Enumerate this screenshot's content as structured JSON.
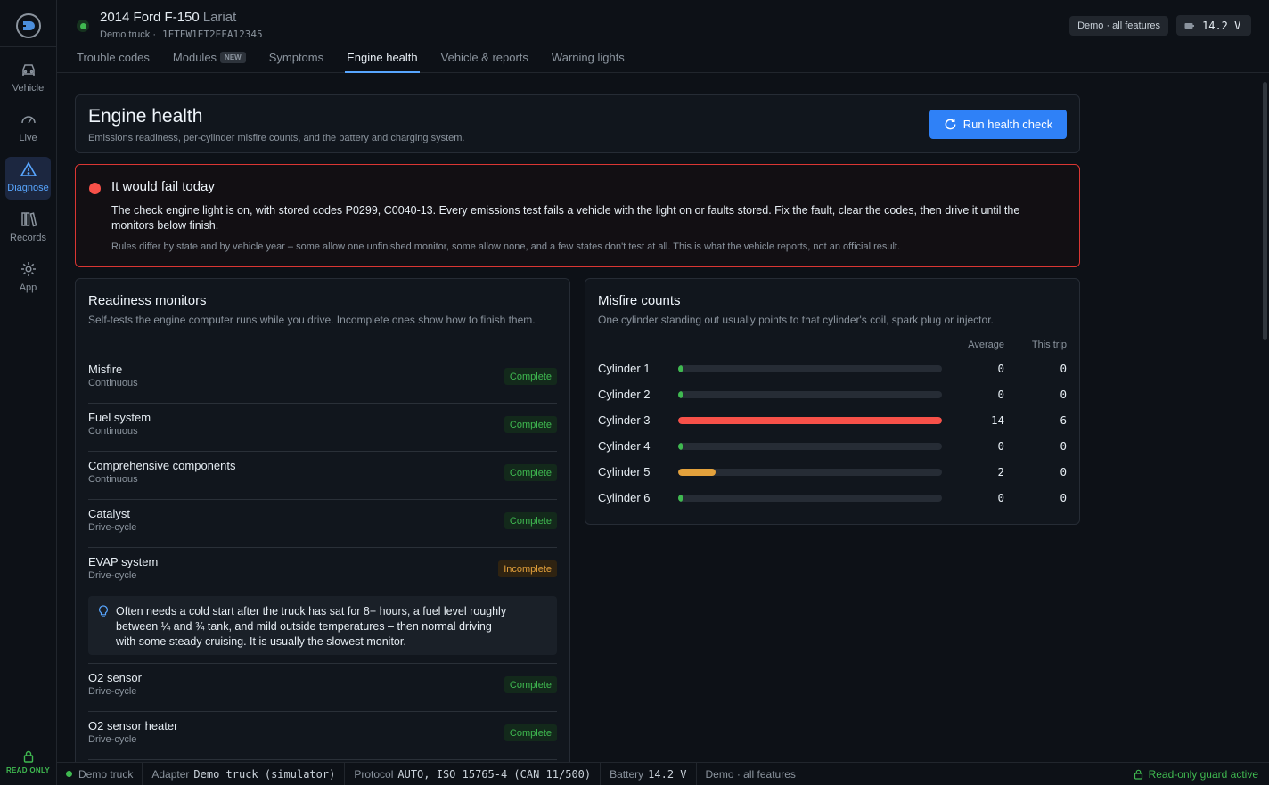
{
  "sidebar": {
    "items": [
      {
        "label": "Vehicle",
        "icon": "car-icon"
      },
      {
        "label": "Live",
        "icon": "gauge-icon"
      },
      {
        "label": "Diagnose",
        "icon": "warning-triangle-icon"
      },
      {
        "label": "Records",
        "icon": "books-icon"
      },
      {
        "label": "App",
        "icon": "gear-icon"
      }
    ],
    "active": "Diagnose",
    "read_only_label": "READ ONLY"
  },
  "header": {
    "vehicle_title": "2014 Ford F-150",
    "vehicle_trim": "Lariat",
    "vehicle_sub": "Demo truck",
    "separator": "·",
    "vin": "1FTEW1ET2EFA12345",
    "demo_chip": "Demo · all features",
    "voltage": "14.2 V",
    "tabs": [
      {
        "label": "Trouble codes"
      },
      {
        "label": "Modules",
        "badge": "NEW"
      },
      {
        "label": "Symptoms"
      },
      {
        "label": "Engine health"
      },
      {
        "label": "Vehicle & reports"
      },
      {
        "label": "Warning lights"
      }
    ],
    "active_tab": "Engine health"
  },
  "hero": {
    "title": "Engine health",
    "subtitle": "Emissions readiness, per-cylinder misfire counts, and the battery and charging system.",
    "button_label": "Run health check"
  },
  "alert": {
    "title": "It would fail today",
    "body": "The check engine light is on, with stored codes P0299, C0040-13. Every emissions test fails a vehicle with the light on or faults stored. Fix the fault, clear the codes, then drive it until the monitors below finish.",
    "note": "Rules differ by state and by vehicle year – some allow one unfinished monitor, some allow none, and a few states don't test at all. This is what the vehicle reports, not an official result.",
    "color": "#f85149"
  },
  "readiness": {
    "title": "Readiness monitors",
    "subtitle": "Self-tests the engine computer runs while you drive. Incomplete ones show how to finish them.",
    "monitors": [
      {
        "name": "Misfire",
        "type": "Continuous",
        "status": "Complete"
      },
      {
        "name": "Fuel system",
        "type": "Continuous",
        "status": "Complete"
      },
      {
        "name": "Comprehensive components",
        "type": "Continuous",
        "status": "Complete"
      },
      {
        "name": "Catalyst",
        "type": "Drive-cycle",
        "status": "Complete"
      },
      {
        "name": "EVAP system",
        "type": "Drive-cycle",
        "status": "Incomplete",
        "tip": "Often needs a cold start after the truck has sat for 8+ hours, a fuel level roughly between ¼ and ¾ tank, and mild outside temperatures – then normal driving with some steady cruising. It is usually the slowest monitor."
      },
      {
        "name": "O2 sensor",
        "type": "Drive-cycle",
        "status": "Complete"
      },
      {
        "name": "O2 sensor heater",
        "type": "Drive-cycle",
        "status": "Complete"
      }
    ]
  },
  "misfire": {
    "title": "Misfire counts",
    "subtitle": "One cylinder standing out usually points to that cylinder's coil, spark plug or injector.",
    "col_average": "Average",
    "col_trip": "This trip",
    "scale_max": 14,
    "cylinders": [
      {
        "label": "Cylinder 1",
        "average": 0,
        "trip": 0,
        "color": "#3fb950"
      },
      {
        "label": "Cylinder 2",
        "average": 0,
        "trip": 0,
        "color": "#3fb950"
      },
      {
        "label": "Cylinder 3",
        "average": 14,
        "trip": 6,
        "color": "#f85149"
      },
      {
        "label": "Cylinder 4",
        "average": 0,
        "trip": 0,
        "color": "#3fb950"
      },
      {
        "label": "Cylinder 5",
        "average": 2,
        "trip": 0,
        "color": "#e3a13c"
      },
      {
        "label": "Cylinder 6",
        "average": 0,
        "trip": 0,
        "color": "#3fb950"
      }
    ]
  },
  "statusbar": {
    "connection": "Demo truck",
    "adapter_label": "Adapter",
    "adapter_value": "Demo truck (simulator)",
    "protocol_label": "Protocol",
    "protocol_value": "AUTO, ISO 15765-4 (CAN 11/500)",
    "battery_label": "Battery",
    "battery_value": "14.2 V",
    "mode": "Demo · all features",
    "guard": "Read-only guard active"
  }
}
